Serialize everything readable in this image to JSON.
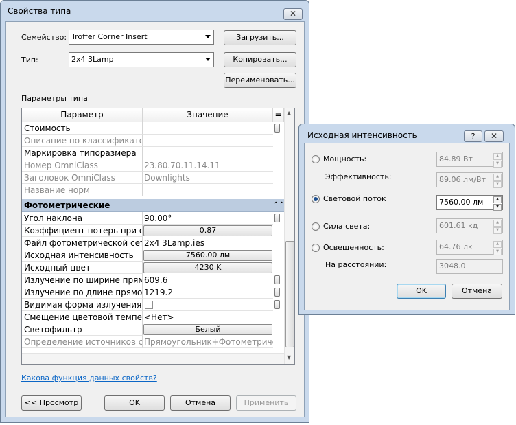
{
  "type_dialog": {
    "title": "Свойства типа",
    "close_glyph": "✕",
    "family_label": "Семейство:",
    "family_value": "Troffer Corner Insert",
    "type_label": "Тип:",
    "type_value": "2x4 3Lamp",
    "load_button": "Загрузить...",
    "copy_button": "Копировать...",
    "rename_button": "Переименовать...",
    "params_label": "Параметры типа",
    "col_param": "Параметр",
    "col_value": "Значение",
    "col_icon": "=",
    "rows_top": [
      {
        "name": "Стоимость",
        "value": ""
      },
      {
        "name": "Описание по классификатору",
        "value": ""
      },
      {
        "name": "Маркировка типоразмера",
        "value": ""
      },
      {
        "name": "Номер OmniClass",
        "value": "23.80.70.11.14.11"
      },
      {
        "name": "Заголовок OmniClass",
        "value": "Downlights"
      },
      {
        "name": "Название норм",
        "value": ""
      }
    ],
    "section_title": "Фотометрические",
    "section_glyph": "⌃⌃",
    "rows_photo": [
      {
        "name": "Угол наклона",
        "value": "90.00°"
      },
      {
        "name": "Коэффициент потерь при осве",
        "value": "0.87"
      },
      {
        "name": "Файл фотометрической сетки",
        "value": "2x4 3Lamp.ies"
      },
      {
        "name": "Исходная интенсивность",
        "value": "7560.00 лм"
      },
      {
        "name": "Исходный цвет",
        "value": "4230 K"
      },
      {
        "name": "Излучение по ширине прямоу",
        "value": "609.6"
      },
      {
        "name": "Излучение по длине прямоуго",
        "value": "1219.2"
      },
      {
        "name": "Видимая форма излучения пр",
        "value": ""
      },
      {
        "name": "Смещение цветовой температ",
        "value": "<Нет>"
      },
      {
        "name": "Светофильтр",
        "value": "Белый"
      },
      {
        "name": "Определение источников свет",
        "value": "Прямоугольник+Фотометрическ"
      }
    ],
    "help_link": "Какова функция данных свойств?",
    "preview_button": "<< Просмотр",
    "ok_button": "OK",
    "cancel_button": "Отмена",
    "apply_button": "Применить"
  },
  "intensity_dialog": {
    "title": "Исходная интенсивность",
    "help_glyph": "?",
    "close_glyph": "✕",
    "power_label": "Мощность:",
    "power_value": "84.89 Вт",
    "efficacy_label": "Эффективность:",
    "efficacy_value": "89.06 лм/Вт",
    "flux_label": "Световой поток",
    "flux_value": "7560.00 лм",
    "intensity_label": "Сила света:",
    "intensity_value": "601.61 кд",
    "illuminance_label": "Освещенность:",
    "illuminance_value": "64.76 лк",
    "distance_label": "На расстоянии:",
    "distance_value": "3048.0",
    "ok_button": "OK",
    "cancel_button": "Отмена",
    "selected_option": "Световой поток"
  }
}
